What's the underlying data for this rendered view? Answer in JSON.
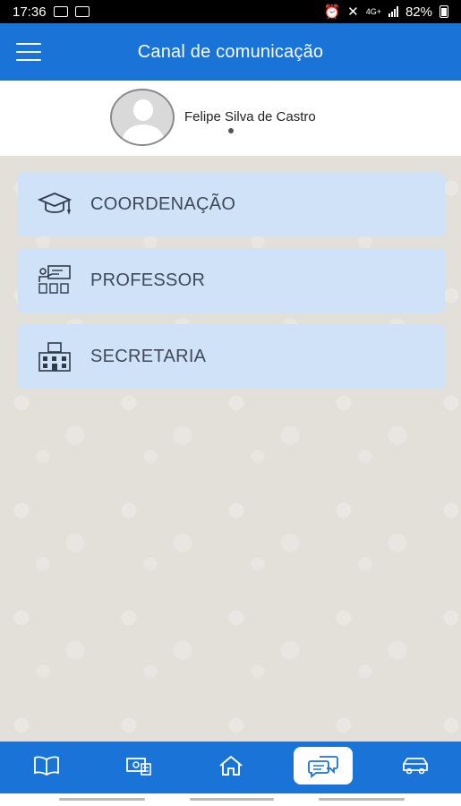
{
  "status_bar": {
    "time": "17:36",
    "network": "4G+",
    "battery": "82%"
  },
  "app_bar": {
    "title": "Canal de comunicação",
    "menu_icon": "hamburger-menu-icon"
  },
  "profile": {
    "name": "Felipe Silva de Castro",
    "avatar_icon": "default-avatar-icon"
  },
  "channels": [
    {
      "label": "COORDENAÇÃO",
      "icon": "graduation-cap-icon"
    },
    {
      "label": "PROFESSOR",
      "icon": "teacher-board-icon"
    },
    {
      "label": "SECRETARIA",
      "icon": "office-building-icon"
    }
  ],
  "bottom_nav": {
    "items": [
      {
        "icon": "book-icon"
      },
      {
        "icon": "finance-icon"
      },
      {
        "icon": "home-icon"
      },
      {
        "icon": "chat-bubbles-icon",
        "active": true
      },
      {
        "icon": "bus-icon"
      }
    ]
  },
  "colors": {
    "primary": "#1a73d6",
    "card": "#cfe2f7",
    "card_text": "#3e4a5b",
    "background": "#e3dfd9"
  }
}
